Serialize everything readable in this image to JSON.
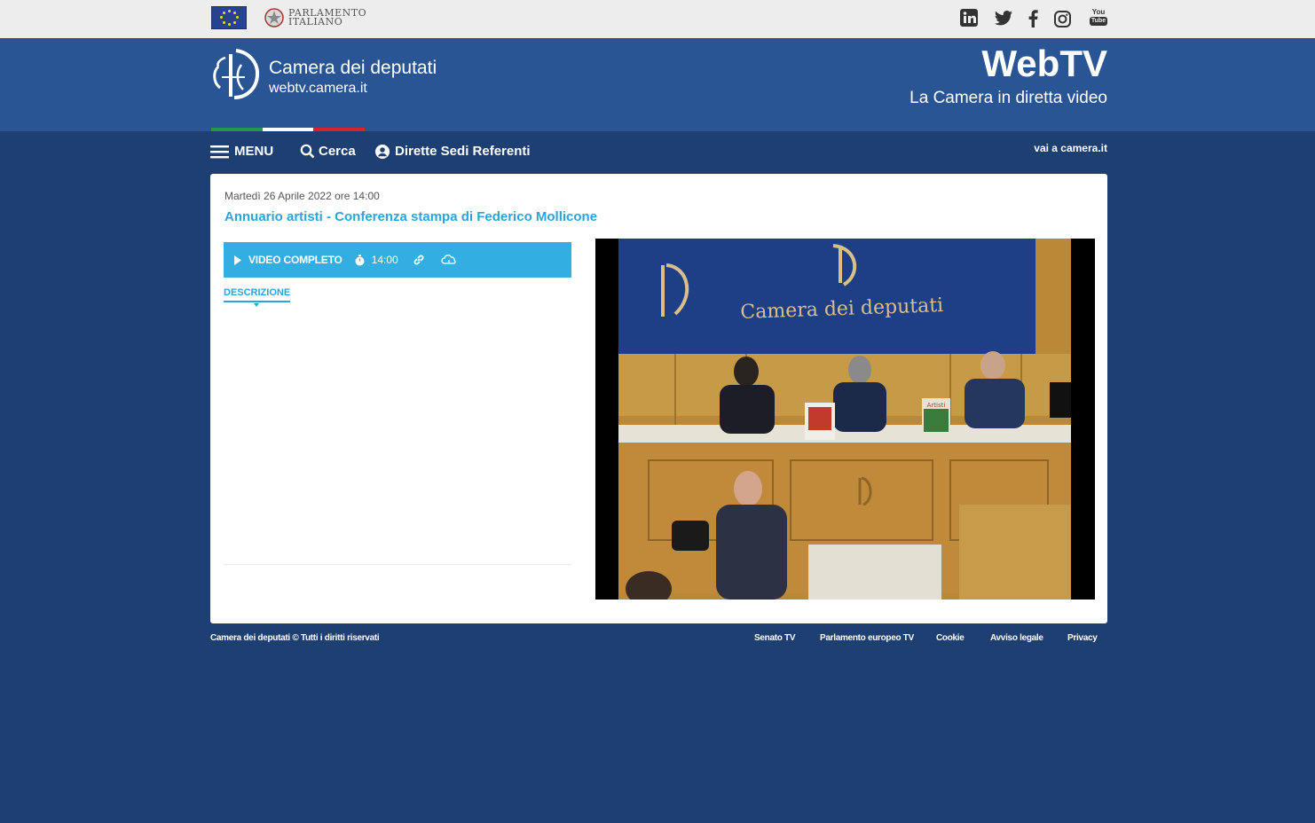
{
  "topbar": {
    "parlamento_line1": "PARLAMENTO",
    "parlamento_line2": "ITALIANO",
    "social_icons": [
      "linkedin-icon",
      "twitter-icon",
      "facebook-icon",
      "instagram-icon",
      "youtube-icon"
    ],
    "youtube_text_top": "You",
    "youtube_text_bottom": "Tube"
  },
  "header": {
    "site_name": "Camera dei deputati",
    "site_url": "webtv.camera.it",
    "brand": "WebTV",
    "tagline": "La Camera in diretta video",
    "tricolor": [
      "#1f9a4a",
      "#ffffff",
      "#d8232a"
    ]
  },
  "nav": {
    "menu_label": "MENU",
    "search_label": "Cerca",
    "dirette_label": "Dirette Sedi Referenti",
    "vai_label": "vai a camera.it"
  },
  "event": {
    "date": "Martedì 26 Aprile 2022 ore 14:00",
    "title": "Annuario artisti - Conferenza stampa di Federico Mollicone",
    "video_label": "VIDEO COMPLETO",
    "video_time": "14:00",
    "description_tab": "DESCRIZIONE"
  },
  "video_scene": {
    "backdrop_text": "Camera dei deputati",
    "book_label": "Artisti"
  },
  "footer": {
    "copyright": "Camera dei deputati © Tutti i diritti riservati",
    "links": [
      "Senato TV",
      "Parlamento europeo TV",
      "Cookie",
      "Avviso legale",
      "Privacy"
    ]
  },
  "colors": {
    "page_bg": "#1d3f72",
    "header_bg": "#2a5595",
    "accent": "#2aa4dc",
    "video_bar": "#33aee3"
  }
}
